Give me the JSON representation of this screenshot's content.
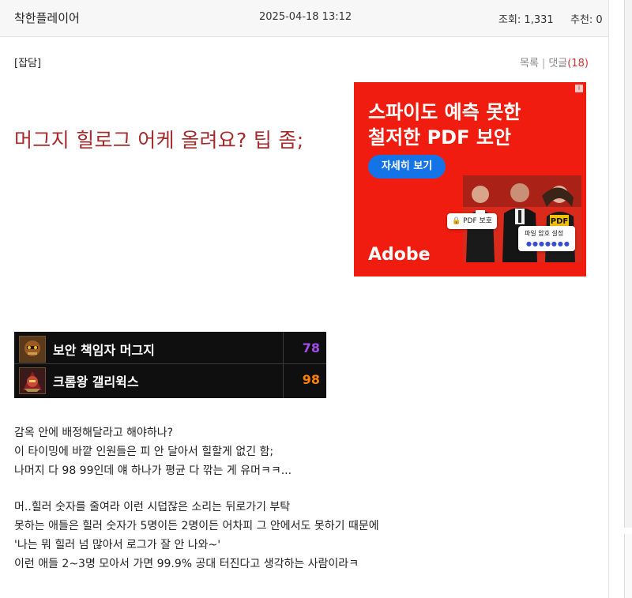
{
  "header": {
    "author": "착한플레이어",
    "date": "2025-04-18 13:12",
    "views": "조회: 1,331",
    "recommend": "추천: 0"
  },
  "post": {
    "category": "[잡담]",
    "list_link": "목록",
    "comments_link": "댓글",
    "comments_count": "(18)",
    "title": "머그지 힐로그 어케 올려요? 팁 좀;"
  },
  "ad": {
    "headline": "스파이도 예측 못한\n철저한 PDF 보안",
    "cta": "자세히 보기",
    "brand": "Adobe",
    "tag1": "PDF 보호",
    "tag2": "파일 암호 설정",
    "tag2_dots": "●●●●●●●",
    "badge_text": "PDF",
    "bg_color": "#ef1c0f",
    "cta_color": "#1473e6"
  },
  "boss_table": {
    "rows": [
      {
        "name": "보안 책임자 머그지",
        "score": "78",
        "score_color": "#a24de6",
        "icon": "mugzee-boss-icon"
      },
      {
        "name": "크롬왕 갤리윅스",
        "score": "98",
        "score_color": "#ff8000",
        "icon": "gallywix-boss-icon"
      }
    ]
  },
  "body": {
    "paragraph1": [
      "감옥 안에 배정해달라고 해야하나?",
      "이 타이밍에 바깥 인원들은 피 안 달아서 힐할게 없긴 함;",
      "나머지 다 98 99인데 얘 하나가 평균 다 깎는 게 유머ㅋㅋ..."
    ],
    "paragraph2": [
      "머..힐러 숫자를 줄여라 이런 시덥잖은 소리는 뒤로가기 부탁",
      "못하는 애들은 힐러 숫자가 5명이든 2명이든 어차피 그 안에서도 못하기 때문에",
      "'나는 뭐 힐러 넘 많아서 로그가 잘 안 나와~'",
      "이런 애들 2~3명 모아서 가면 99.9% 공대 터진다고 생각하는 사람이라ㅋ"
    ]
  }
}
